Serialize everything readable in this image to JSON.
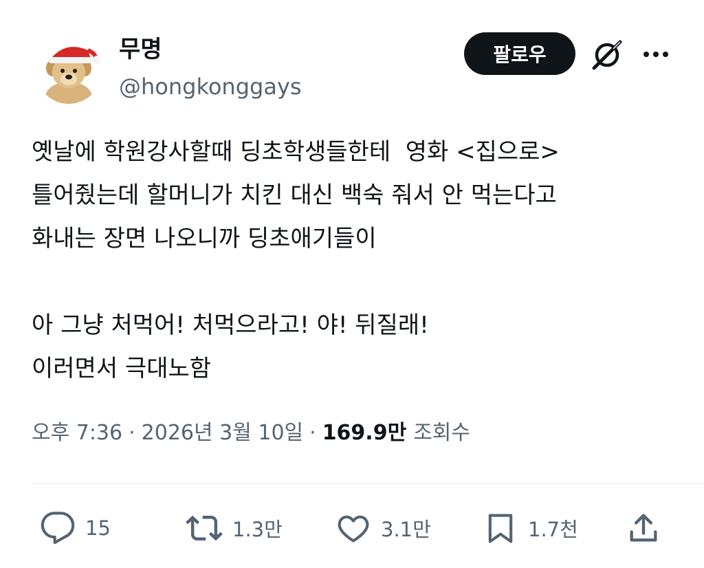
{
  "user": {
    "display_name": "무명",
    "handle": "@hongkonggays",
    "avatar_icon": "dog-with-santa-hat-avatar"
  },
  "header": {
    "follow_label": "팔로우",
    "grok_icon": "slashed-circle-icon",
    "more_icon": "more-dots-icon"
  },
  "tweet": {
    "lines": [
      "옛날에 학원강사할때 딩초학생들한테  영화 <집으로>",
      "틀어줬는데 할머니가 치킨 대신 백숙 줘서 안 먹는다고",
      "화내는 장면 나오니까 딩초애기들이",
      "",
      "아 그냥 처먹어! 처먹으라고! 야! 뒤질래!",
      "이러면서 극대노함"
    ]
  },
  "meta": {
    "time": "오후 7:36",
    "separator": "·",
    "date": "2026년 3월 10일",
    "views_count": "169.9만",
    "views_label": "조회수"
  },
  "actions": {
    "reply_count": "15",
    "retweet_count": "1.3만",
    "like_count": "3.1만",
    "bookmark_count": "1.7천"
  },
  "colors": {
    "text": "#0f1419",
    "secondary": "#536471",
    "divider": "#e7e9ea",
    "button_bg": "#0f1419"
  }
}
